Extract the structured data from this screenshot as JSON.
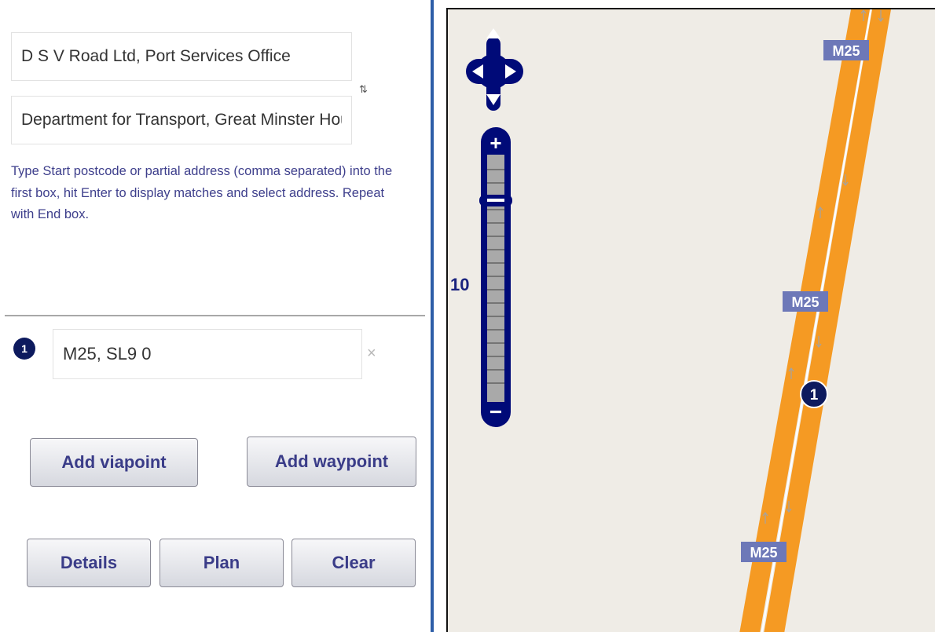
{
  "route": {
    "start_value": "D S V Road Ltd, Port Services Office",
    "end_value": "Department for Transport, Great Minster House",
    "swap_symbol": "⇅",
    "hint": "Type Start postcode or partial address (comma separated) into the first box, hit Enter to display matches and select address. Repeat with End box."
  },
  "waypoint": {
    "number": "1",
    "value": "M25, SL9 0",
    "remove_symbol": "×"
  },
  "buttons": {
    "add_viapoint": "Add viapoint",
    "add_waypoint": "Add waypoint",
    "details": "Details",
    "plan": "Plan",
    "clear": "Clear"
  },
  "map": {
    "zoom_level": "10",
    "zoom_in": "+",
    "zoom_out": "−",
    "road_label": "M25",
    "marker_number": "1",
    "colors": {
      "background": "#efece6",
      "motorway": "#f59a23",
      "control": "#000a78",
      "shield": "#6d78b8",
      "marker": "#0d1a5e"
    }
  }
}
